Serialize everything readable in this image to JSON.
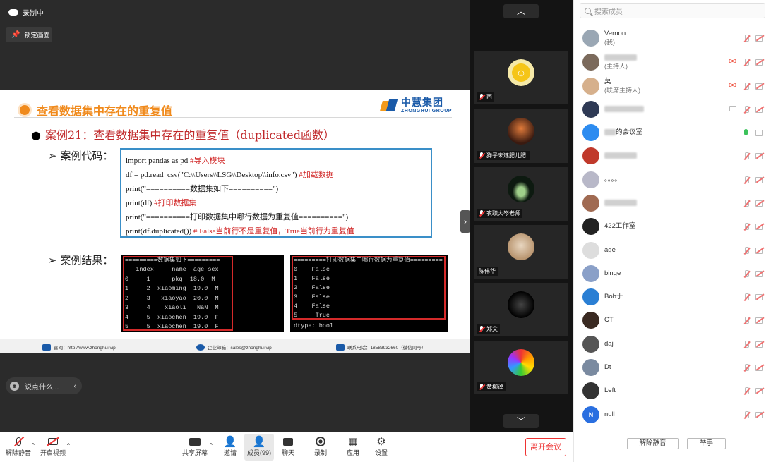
{
  "recording": {
    "label": "录制中"
  },
  "lock_button": {
    "label": "锁定画面"
  },
  "slide": {
    "title": "查看数据集中存在的重复值",
    "logo_cn": "中慧集团",
    "logo_en": "ZHONGHUI GROUP",
    "case_prefix": "案例21：",
    "case_text": "查看数据集中存在的重复值（duplicated函数）",
    "code_label": "案例代码：",
    "result_label": "案例结果：",
    "code_lines": [
      {
        "code": "import pandas as pd  ",
        "comment": "#导入模块"
      },
      {
        "code": "df = pd.read_csv(\"C:\\\\Users\\\\LSG\\\\Desktop\\\\info.csv\") ",
        "comment": "#加载数据"
      },
      {
        "code": "print(\"==========数据集如下==========\")",
        "comment": ""
      },
      {
        "code": "print(df) ",
        "comment": "#打印数据集"
      },
      {
        "code": "print(\"==========打印数据集中哪行数据为重复值==========\")",
        "comment": ""
      },
      {
        "code": "print(df.duplicated()) ",
        "comment": "# False当前行不是重复值，True当前行为重复值"
      }
    ],
    "term1_lines": [
      "=========数据集如下=========",
      "   index     name  age sex",
      "0     1      pkq  18.0  M",
      "1     2  xiaoming  19.0  M",
      "2     3   xiaoyao  20.0  M",
      "3     4    xiaoli   NaN  M",
      "4     5  xiaochen  19.0  F",
      "5     5  xiaochen  19.0  F"
    ],
    "term2_lines": [
      "=========打印数据集中哪行数据为重复值=========",
      "0    False",
      "1    False",
      "2    False",
      "3    False",
      "4    False",
      "5     True",
      "dtype: bool"
    ],
    "footer": {
      "site": "官网：http://www.zhonghui.vip",
      "email": "企业邮箱：sales@zhonghui.vip",
      "phone": "联系电话：18583932660（微信同号）"
    }
  },
  "chat_input": {
    "placeholder": "说点什么..."
  },
  "video_tiles": [
    {
      "name": "西"
    },
    {
      "name": "狗子未遂肥儿肥."
    },
    {
      "name": "农职大岑老师"
    },
    {
      "name": "陈伟华"
    },
    {
      "name": "郑文"
    },
    {
      "name": "黄柳淖"
    }
  ],
  "toolbar": {
    "unmute": "解除静音",
    "start_video": "开启视频",
    "share_screen": "共享屏幕",
    "invite": "邀请",
    "members": "成员(99)",
    "chat": "聊天",
    "record": "录制",
    "apps": "应用",
    "settings": "设置",
    "leave": "离开会议"
  },
  "panel": {
    "search_placeholder": "搜索成员",
    "members": [
      {
        "name": "Vernon",
        "sub": "(我)",
        "color": "#9aa7b4"
      },
      {
        "name": "",
        "sub": "(主持人)",
        "color": "#7b6a5c"
      },
      {
        "name": "莫",
        "sub": "(联席主持人)",
        "color": "#d6b08c"
      },
      {
        "name": "",
        "sub": "",
        "color": "#2f3a55"
      },
      {
        "name": "的会议室",
        "sub": "",
        "color": "#2d8cf0"
      },
      {
        "name": "",
        "sub": "",
        "color": "#c0392b"
      },
      {
        "name": "。。。。",
        "sub": "",
        "color": "#b8b8c8"
      },
      {
        "name": "",
        "sub": "",
        "color": "#a06a52"
      },
      {
        "name": "422工作室",
        "sub": "",
        "color": "#222"
      },
      {
        "name": "age",
        "sub": "",
        "color": "#ddd"
      },
      {
        "name": "binge",
        "sub": "",
        "color": "#8aa0c8"
      },
      {
        "name": "Bob于",
        "sub": "",
        "color": "#2a7fd4"
      },
      {
        "name": "CT",
        "sub": "",
        "color": "#3a2a22"
      },
      {
        "name": "daj",
        "sub": "",
        "color": "#555"
      },
      {
        "name": "Dt",
        "sub": "",
        "color": "#7a8aa0"
      },
      {
        "name": "Left",
        "sub": "",
        "color": "#333"
      },
      {
        "name": "null",
        "sub": "",
        "color": "#2a6fe0",
        "initial": "N"
      }
    ],
    "unmute_all": "解除静音",
    "raise_hand": "举手"
  }
}
